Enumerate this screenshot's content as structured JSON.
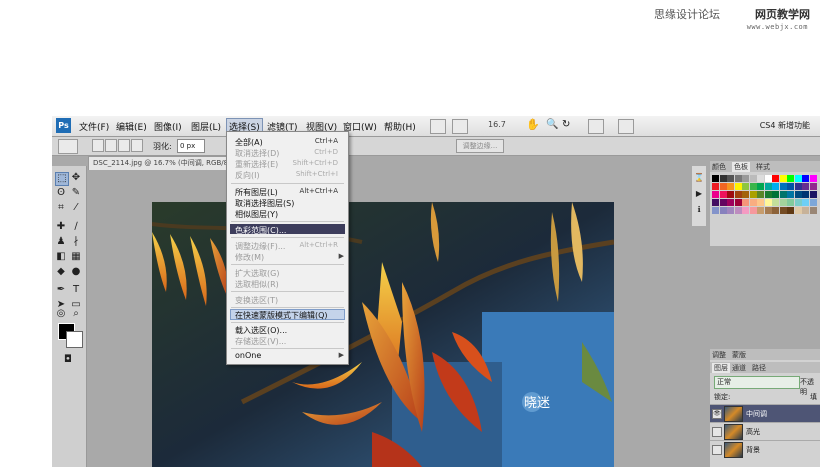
{
  "watermark": {
    "site_cn": "思缘设计论坛",
    "site2_cn": "网页教学网",
    "url": "www.webjx.com",
    "canvas_mark": "晓迷"
  },
  "app": {
    "logo": "Ps",
    "workspace": "CS4 新增功能",
    "zoom": "16.7"
  },
  "menubar": {
    "items": [
      "文件(F)",
      "编辑(E)",
      "图像(I)",
      "图层(L)",
      "选择(S)",
      "滤镜(T)",
      "视图(V)",
      "窗口(W)",
      "帮助(H)"
    ]
  },
  "options": {
    "feather_label": "羽化:",
    "feather_value": "0 px",
    "refine_edge": "调整边缘..."
  },
  "document": {
    "tab_title": "DSC_2114.jpg @ 16.7% (中间调, RGB/8)"
  },
  "select_menu": {
    "all": {
      "label": "全部(A)",
      "shortcut": "Ctrl+A"
    },
    "deselect": {
      "label": "取消选择(D)",
      "shortcut": "Ctrl+D"
    },
    "reselect": {
      "label": "重新选择(E)",
      "shortcut": "Shift+Ctrl+D"
    },
    "inverse": {
      "label": "反向(I)",
      "shortcut": "Shift+Ctrl+I"
    },
    "all_layers": {
      "label": "所有图层(L)",
      "shortcut": "Alt+Ctrl+A"
    },
    "deselect_layers": {
      "label": "取消选择图层(S)"
    },
    "similar_layers": {
      "label": "相似图层(Y)"
    },
    "color_range": {
      "label": "色彩范围(C)..."
    },
    "refine_edge": {
      "label": "调整边缘(F)...",
      "shortcut": "Alt+Ctrl+R"
    },
    "modify": {
      "label": "修改(M)"
    },
    "grow": {
      "label": "扩大选取(G)"
    },
    "similar": {
      "label": "选取相似(R)"
    },
    "transform": {
      "label": "变换选区(T)"
    },
    "quick_mask": {
      "label": "在快速蒙版模式下编辑(Q)"
    },
    "load": {
      "label": "载入选区(O)..."
    },
    "save": {
      "label": "存储选区(V)..."
    },
    "onone": {
      "label": "onOne"
    }
  },
  "panels": {
    "swatch_tabs": [
      "颜色",
      "色板",
      "样式"
    ],
    "adjust_tabs": [
      "调整",
      "蒙版"
    ],
    "layer_tabs": [
      "图层",
      "通道",
      "路径"
    ],
    "blend_mode": "正常",
    "opacity_label": "不透明",
    "lock_label": "锁定:",
    "fill_label": "填",
    "layers": [
      "中间调",
      "高光",
      "背景"
    ]
  },
  "swatch_colors": [
    "#000000",
    "#333333",
    "#555555",
    "#777777",
    "#999999",
    "#bbbbbb",
    "#dddddd",
    "#ffffff",
    "#ff0000",
    "#ffff00",
    "#00ff00",
    "#00ffff",
    "#0000ff",
    "#ff00ff",
    "#ed1c24",
    "#f26522",
    "#f7941d",
    "#fff200",
    "#8dc63f",
    "#39b54a",
    "#00a651",
    "#00a99d",
    "#00aeef",
    "#0072bc",
    "#0054a6",
    "#2e3192",
    "#662d91",
    "#92278f",
    "#ec008c",
    "#ed145b",
    "#9e0b0f",
    "#a0410d",
    "#a36209",
    "#aba000",
    "#598527",
    "#1a7b30",
    "#007236",
    "#00746b",
    "#0076a3",
    "#004b80",
    "#003471",
    "#1b1464",
    "#440e62",
    "#630460",
    "#9e005d",
    "#9e0039",
    "#f69679",
    "#f9ad81",
    "#fdc68a",
    "#fff799",
    "#c4df9b",
    "#a3d39c",
    "#82ca9c",
    "#7accc8",
    "#6dcff6",
    "#7da7d9",
    "#8393ca",
    "#8781bd",
    "#a186be",
    "#bd8cbf",
    "#f49ac2",
    "#f6989d",
    "#c69c6d",
    "#a67c52",
    "#8c6239",
    "#754c24",
    "#603913",
    "#e0c9a6",
    "#c7b299",
    "#998675"
  ]
}
